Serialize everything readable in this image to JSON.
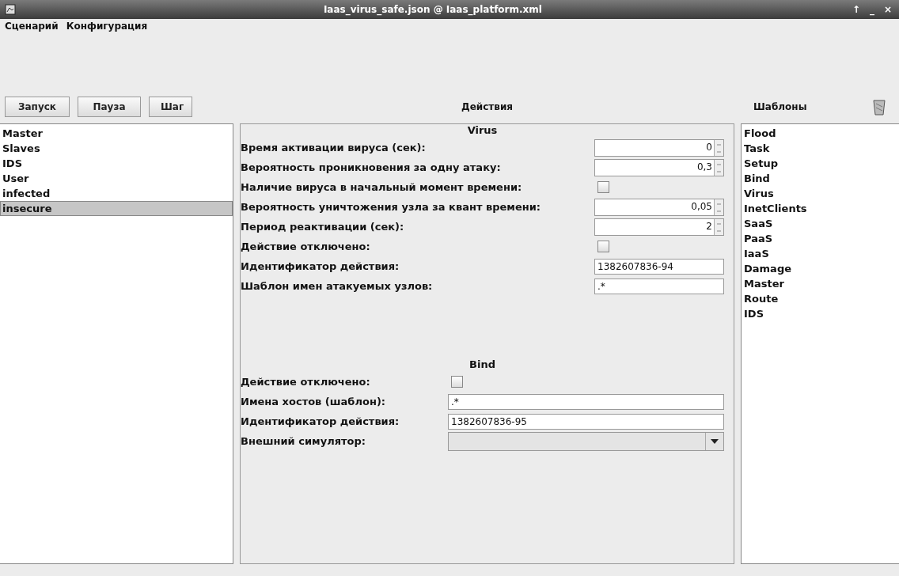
{
  "window": {
    "title": "Iaas_virus_safe.json @ Iaas_platform.xml",
    "controls": [
      "↑",
      "_",
      "×"
    ]
  },
  "menu": [
    "Сценарий",
    "Конфигурация"
  ],
  "toolbar": {
    "buttons": [
      "Запуск",
      "Пауза",
      "Шаг"
    ]
  },
  "actions_title": "Действия",
  "templates_title": "Шаблоны",
  "nodes": [
    {
      "label": "Master",
      "selected": false
    },
    {
      "label": "Slaves",
      "selected": false
    },
    {
      "label": "IDS",
      "selected": false
    },
    {
      "label": "User",
      "selected": false
    },
    {
      "label": "infected",
      "selected": false
    },
    {
      "label": "insecure",
      "selected": true
    }
  ],
  "sections": [
    {
      "title": "Virus",
      "fields": [
        {
          "kind": "spinner",
          "label": "Время активации вируса (сек):",
          "value": "0"
        },
        {
          "kind": "spinner",
          "label": "Вероятность проникновения за одну атаку:",
          "value": "0,3"
        },
        {
          "kind": "checkbox",
          "label": "Наличие вируса в начальный момент времени:",
          "checked": false
        },
        {
          "kind": "spinner",
          "label": "Вероятность уничтожения узла за квант времени:",
          "value": "0,05"
        },
        {
          "kind": "spinner",
          "label": "Период реактивации (сек):",
          "value": "2"
        },
        {
          "kind": "checkbox",
          "label": "Действие отключено:",
          "checked": false
        },
        {
          "kind": "text",
          "label": "Идентификатор действия:",
          "value": "1382607836-94"
        },
        {
          "kind": "text",
          "label": "Шаблон имен атакуемых узлов:",
          "value": ".*"
        }
      ]
    },
    {
      "title": "Bind",
      "fields": [
        {
          "kind": "checkbox",
          "label": "Действие отключено:",
          "checked": false
        },
        {
          "kind": "text",
          "label": "Имена хостов (шаблон):",
          "value": ".*"
        },
        {
          "kind": "text",
          "label": "Идентификатор действия:",
          "value": "1382607836-95"
        },
        {
          "kind": "combo",
          "label": "Внешний симулятор:"
        }
      ]
    }
  ],
  "templates": [
    "Flood",
    "Task",
    "Setup",
    "Bind",
    "Virus",
    "InetClients",
    "SaaS",
    "PaaS",
    "IaaS",
    "Damage",
    "Master",
    "Route",
    "IDS"
  ]
}
